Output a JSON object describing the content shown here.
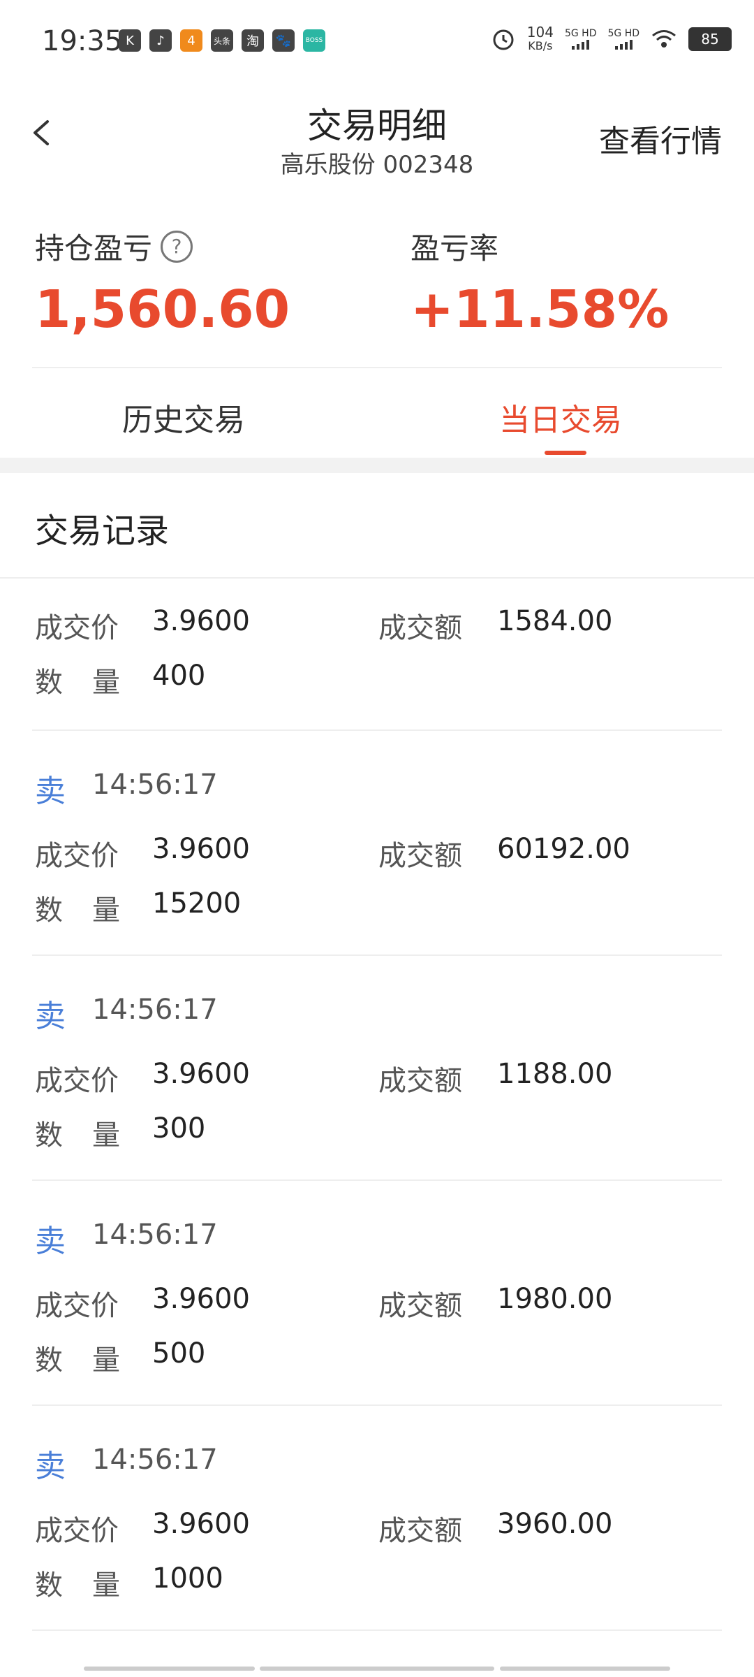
{
  "status_bar": {
    "time": "19:35",
    "network_speed": "104",
    "network_unit": "KB/s",
    "signal1": "5G HD",
    "signal2": "5G HD",
    "battery": "85",
    "apps": [
      "K",
      "♪",
      "4",
      "头条",
      "淘",
      "🐾",
      "BOSS"
    ]
  },
  "header": {
    "title": "交易明细",
    "subtitle": "高乐股份  002348",
    "market_link": "查看行情"
  },
  "summary": {
    "pnl_label": "持仓盈亏",
    "pnl_value": "1,560.60",
    "rate_label": "盈亏率",
    "rate_value": "+11.58%",
    "help_icon": "?"
  },
  "tabs": [
    {
      "label": "历史交易",
      "active": false
    },
    {
      "label": "当日交易",
      "active": true
    }
  ],
  "records_title": "交易记录",
  "labels": {
    "price": "成交价",
    "amount": "成交额",
    "qty_a": "数",
    "qty_b": "量"
  },
  "records": [
    {
      "side": "",
      "time": "",
      "price": "3.9600",
      "amount": "1584.00",
      "qty": "400"
    },
    {
      "side": "卖",
      "time": "14:56:17",
      "price": "3.9600",
      "amount": "60192.00",
      "qty": "15200"
    },
    {
      "side": "卖",
      "time": "14:56:17",
      "price": "3.9600",
      "amount": "1188.00",
      "qty": "300"
    },
    {
      "side": "卖",
      "time": "14:56:17",
      "price": "3.9600",
      "amount": "1980.00",
      "qty": "500"
    },
    {
      "side": "卖",
      "time": "14:56:17",
      "price": "3.9600",
      "amount": "3960.00",
      "qty": "1000"
    }
  ],
  "colors": {
    "accent": "#e84a2e",
    "sell": "#4a7fd8"
  }
}
